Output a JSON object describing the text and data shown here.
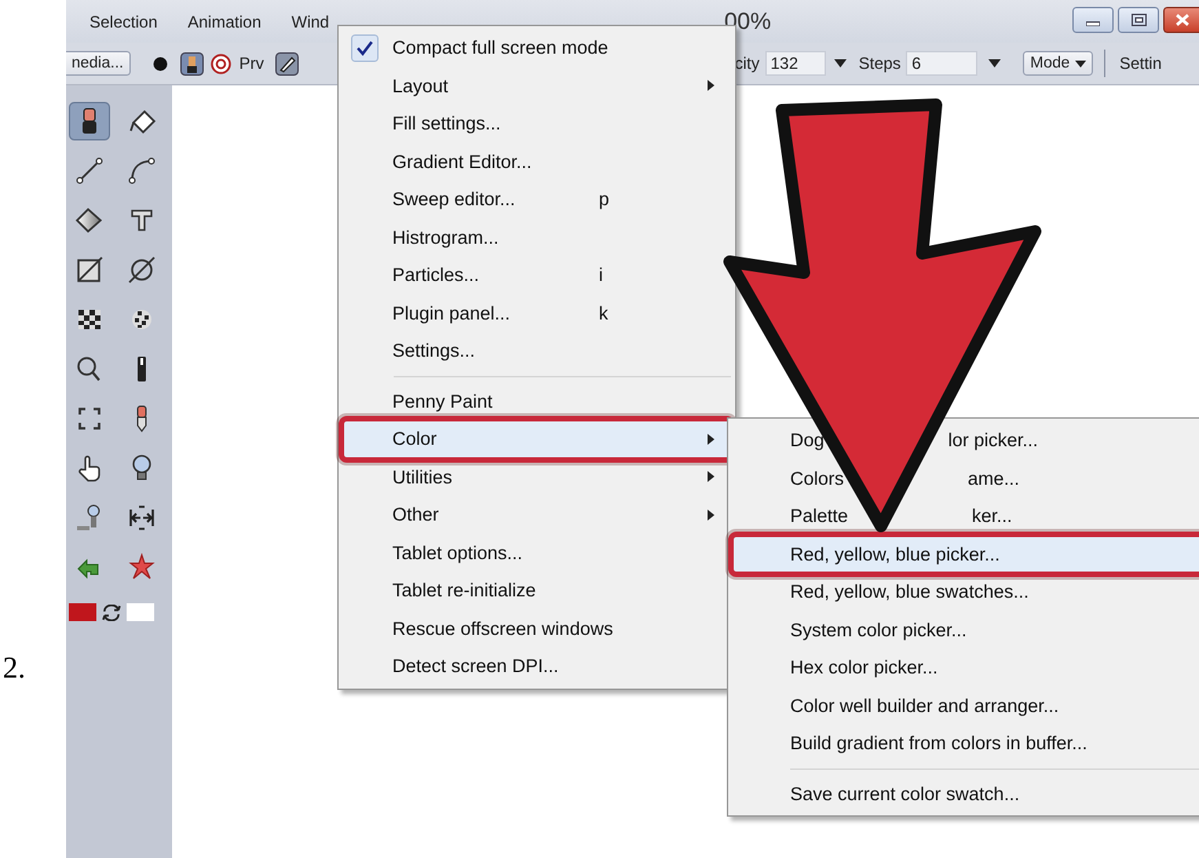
{
  "step_number": "2.",
  "menubar": {
    "items": [
      "Selection",
      "Animation",
      "Wind"
    ],
    "title": "00%"
  },
  "toolbar": {
    "media_button": "nedia...",
    "preview_label": "Prv",
    "opacity_label": "city",
    "opacity_value": "132",
    "steps_label": "Steps",
    "steps_value": "6",
    "mode_button": "Mode",
    "settings_label": "Settin"
  },
  "tools": [
    {
      "kind": "brush",
      "selected": true
    },
    {
      "kind": "bucket",
      "selected": false
    },
    {
      "kind": "line",
      "selected": false
    },
    {
      "kind": "curve",
      "selected": false
    },
    {
      "kind": "gradient",
      "selected": false
    },
    {
      "kind": "text",
      "selected": false
    },
    {
      "kind": "rect",
      "selected": false
    },
    {
      "kind": "ellipse",
      "selected": false
    },
    {
      "kind": "checker",
      "selected": false
    },
    {
      "kind": "dots",
      "selected": false
    },
    {
      "kind": "magnifier",
      "selected": false
    },
    {
      "kind": "bar",
      "selected": false
    },
    {
      "kind": "select",
      "selected": false
    },
    {
      "kind": "dropper",
      "selected": false
    },
    {
      "kind": "hand",
      "selected": false
    },
    {
      "kind": "bulb",
      "selected": false
    },
    {
      "kind": "clone",
      "selected": false
    },
    {
      "kind": "spacing",
      "selected": false
    },
    {
      "kind": "undo",
      "selected": false
    },
    {
      "kind": "pin",
      "selected": false
    }
  ],
  "color_swatches": [
    {
      "color": "#c0161c"
    },
    {
      "color": "#ffffff"
    }
  ],
  "main_menu": {
    "items": [
      {
        "kind": "item",
        "label": "Compact full screen mode",
        "checked": true,
        "has_submenu": false,
        "highlighted": false
      },
      {
        "kind": "item",
        "label": "Layout",
        "checked": false,
        "has_submenu": true,
        "highlighted": false
      },
      {
        "kind": "item",
        "label": "Fill settings...",
        "checked": false,
        "has_submenu": false,
        "highlighted": false
      },
      {
        "kind": "item",
        "label": "Gradient Editor...",
        "checked": false,
        "has_submenu": false,
        "highlighted": false
      },
      {
        "kind": "item",
        "label": "Sweep editor...",
        "shortcut": "p",
        "checked": false,
        "has_submenu": false,
        "highlighted": false
      },
      {
        "kind": "item",
        "label": "Histrogram...",
        "checked": false,
        "has_submenu": false,
        "highlighted": false
      },
      {
        "kind": "item",
        "label": "Particles...",
        "shortcut": "i",
        "checked": false,
        "has_submenu": false,
        "highlighted": false
      },
      {
        "kind": "item",
        "label": "Plugin panel...",
        "shortcut": "k",
        "checked": false,
        "has_submenu": false,
        "highlighted": false
      },
      {
        "kind": "item",
        "label": "Settings...",
        "checked": false,
        "has_submenu": false,
        "highlighted": false
      },
      {
        "kind": "separator"
      },
      {
        "kind": "item",
        "label": "Penny Paint",
        "checked": false,
        "has_submenu": false,
        "highlighted": false
      },
      {
        "kind": "item",
        "label": "Color",
        "checked": false,
        "has_submenu": true,
        "highlighted": true
      },
      {
        "kind": "item",
        "label": "Utilities",
        "checked": false,
        "has_submenu": true,
        "highlighted": false
      },
      {
        "kind": "item",
        "label": "Other",
        "checked": false,
        "has_submenu": true,
        "highlighted": false
      },
      {
        "kind": "item",
        "label": "Tablet options...",
        "checked": false,
        "has_submenu": false,
        "highlighted": false
      },
      {
        "kind": "item",
        "label": "Tablet re-initialize",
        "checked": false,
        "has_submenu": false,
        "highlighted": false
      },
      {
        "kind": "item",
        "label": "Rescue offscreen windows",
        "checked": false,
        "has_submenu": false,
        "highlighted": false
      },
      {
        "kind": "item",
        "label": "Detect screen DPI...",
        "checked": false,
        "has_submenu": false,
        "highlighted": false
      }
    ]
  },
  "color_submenu": {
    "items": [
      {
        "kind": "item",
        "parts": [
          "Dog",
          "lor picker..."
        ],
        "highlighted": false
      },
      {
        "kind": "item",
        "parts": [
          "Colors",
          "ame..."
        ],
        "highlighted": false
      },
      {
        "kind": "item",
        "parts": [
          "Palette",
          "ker..."
        ],
        "highlighted": false
      },
      {
        "kind": "item",
        "parts": [
          "Red, yellow, blue picker..."
        ],
        "highlighted": true
      },
      {
        "kind": "item",
        "parts": [
          "Red, yellow, blue swatches..."
        ],
        "highlighted": false
      },
      {
        "kind": "item",
        "parts": [
          "System color picker..."
        ],
        "highlighted": false
      },
      {
        "kind": "item",
        "parts": [
          "Hex color picker..."
        ],
        "highlighted": false
      },
      {
        "kind": "item",
        "parts": [
          "Color well builder and arranger..."
        ],
        "highlighted": false
      },
      {
        "kind": "item",
        "parts": [
          "Build gradient from colors in buffer..."
        ],
        "highlighted": false
      },
      {
        "kind": "separator"
      },
      {
        "kind": "item",
        "parts": [
          "Save current color swatch..."
        ],
        "highlighted": false
      }
    ]
  }
}
